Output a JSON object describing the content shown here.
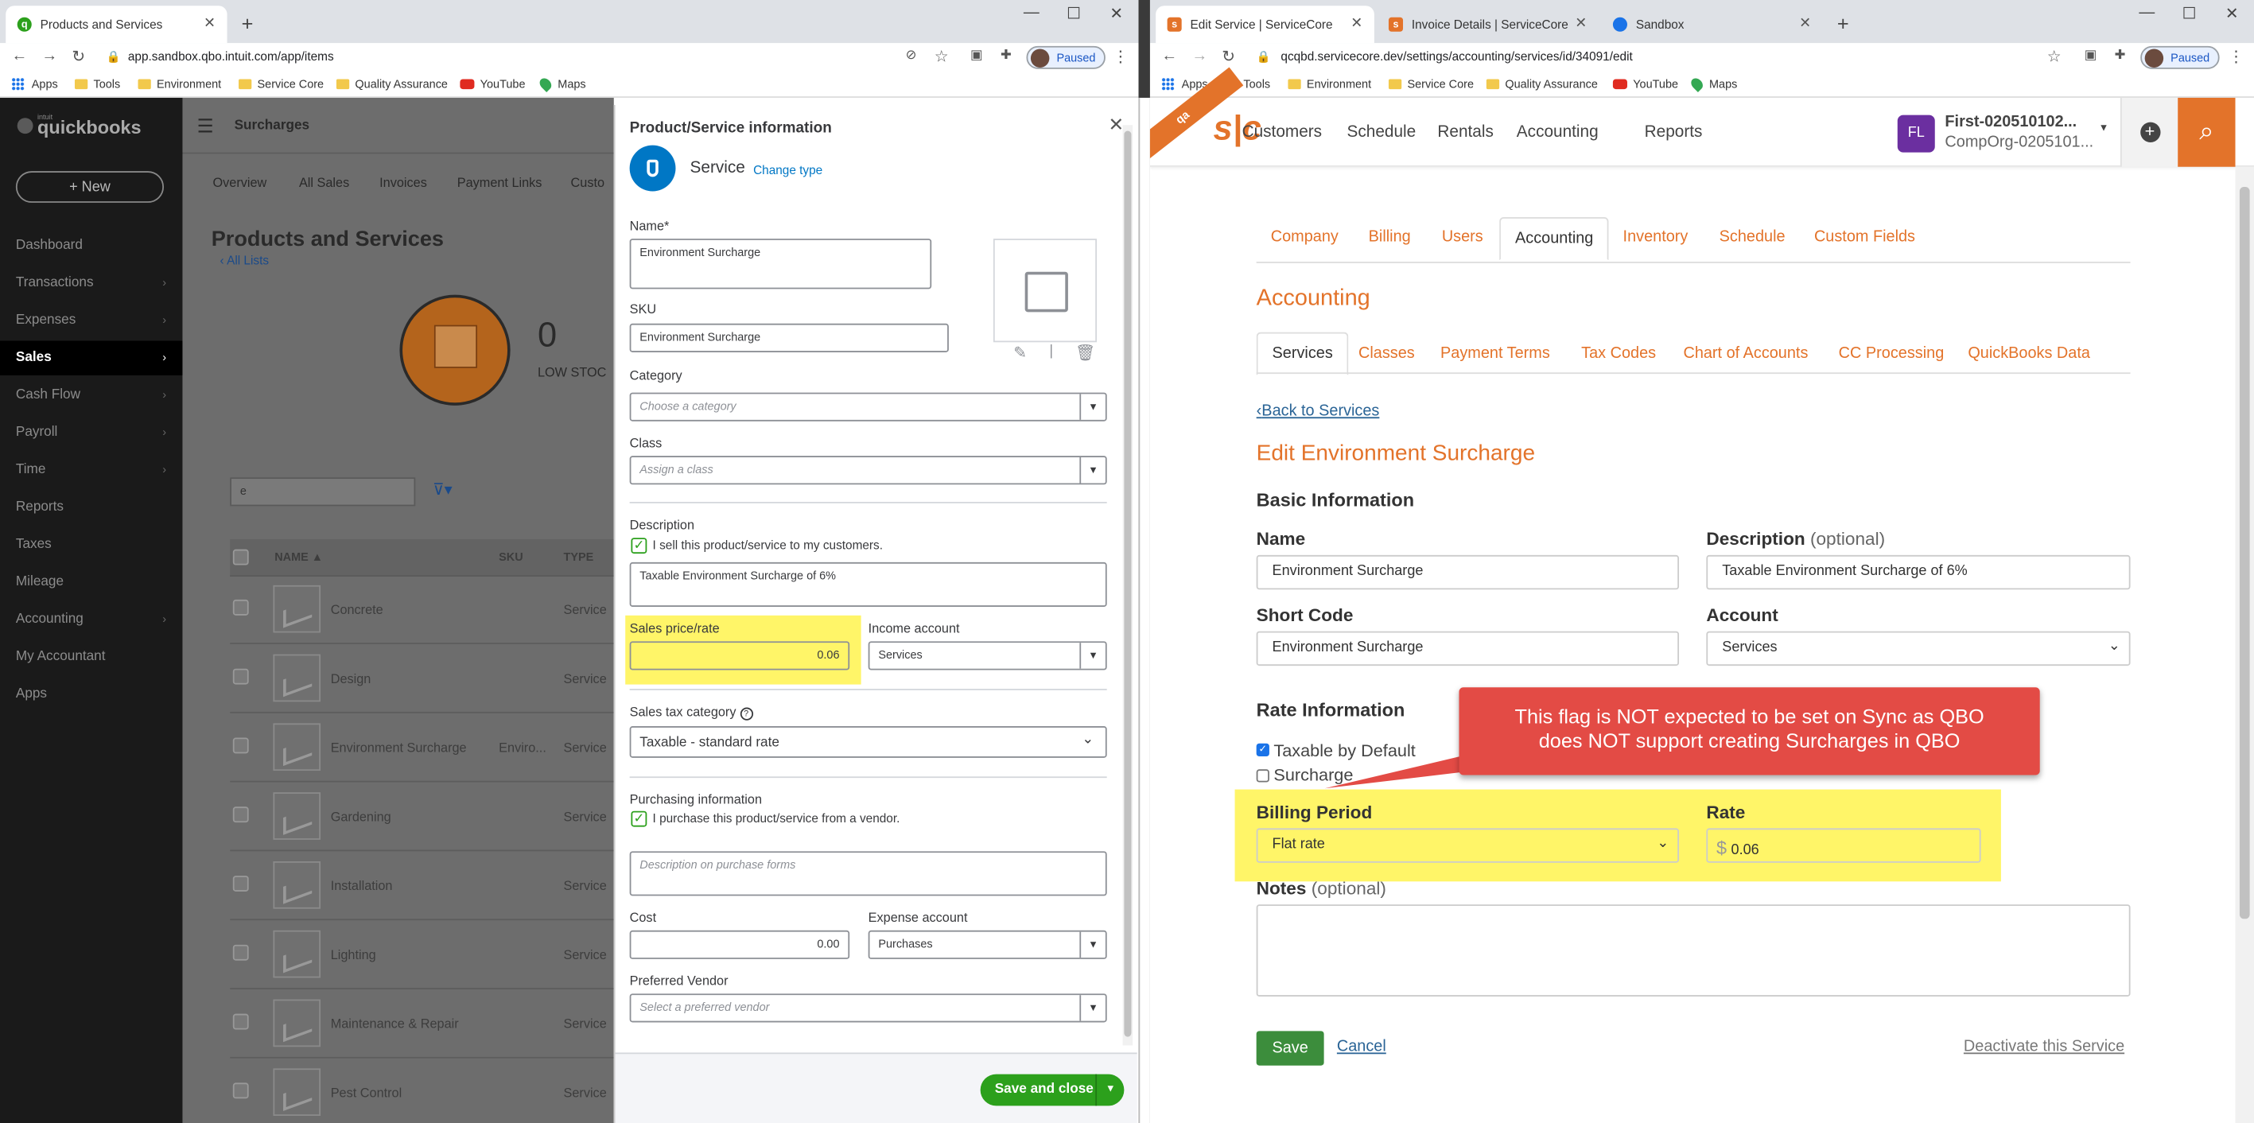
{
  "qbo_window": {
    "tab_title": "Products and Services",
    "url": "app.sandbox.qbo.intuit.com/app/items",
    "paused_label": "Paused",
    "bookmarks": [
      "Apps",
      "Tools",
      "Environment",
      "Service Core",
      "Quality Assurance",
      "YouTube",
      "Maps"
    ],
    "logo": "quickbooks",
    "logo_small": "intuit",
    "new_button": "+ New",
    "sidebar": [
      "Dashboard",
      "Transactions",
      "Expenses",
      "Sales",
      "Cash Flow",
      "Payroll",
      "Time",
      "Reports",
      "Taxes",
      "Mileage",
      "Accounting",
      "My Accountant",
      "Apps"
    ],
    "sidebar_active": "Sales",
    "header_title": "Surcharges",
    "subtabs": [
      "Overview",
      "All Sales",
      "Invoices",
      "Payment Links",
      "Custo"
    ],
    "page_title": "Products and Services",
    "all_lists": "All Lists",
    "low_stock_count": "0",
    "low_stock_label": "LOW STOC",
    "search_value": "e",
    "columns": [
      "NAME ▲",
      "SKU",
      "TYPE"
    ],
    "rows": [
      {
        "name": "Concrete",
        "sku": "",
        "type": "Service"
      },
      {
        "name": "Design",
        "sku": "",
        "type": "Service"
      },
      {
        "name": "Environment Surcharge",
        "sku": "Enviro...",
        "type": "Service"
      },
      {
        "name": "Gardening",
        "sku": "",
        "type": "Service"
      },
      {
        "name": "Installation",
        "sku": "",
        "type": "Service"
      },
      {
        "name": "Lighting",
        "sku": "",
        "type": "Service"
      },
      {
        "name": "Maintenance & Repair",
        "sku": "",
        "type": "Service"
      },
      {
        "name": "Pest Control",
        "sku": "",
        "type": "Service"
      }
    ]
  },
  "drawer": {
    "title": "Product/Service information",
    "type_label": "Service",
    "change_type": "Change type",
    "name_label": "Name*",
    "name_value": "Environment Surcharge",
    "sku_label": "SKU",
    "sku_value": "Environment Surcharge",
    "category_label": "Category",
    "category_placeholder": "Choose a category",
    "class_label": "Class",
    "class_placeholder": "Assign a class",
    "description_label": "Description",
    "sell_checkbox": "I sell this product/service to my customers.",
    "description_value": "Taxable Environment Surcharge of 6%",
    "price_label": "Sales price/rate",
    "price_value": "0.06",
    "income_label": "Income account",
    "income_value": "Services",
    "tax_label": "Sales tax category",
    "tax_value": "Taxable - standard rate",
    "purchasing_label": "Purchasing information",
    "purchase_checkbox": "I purchase this product/service from a vendor.",
    "purchase_desc_placeholder": "Description on purchase forms",
    "cost_label": "Cost",
    "cost_value": "0.00",
    "expense_label": "Expense account",
    "expense_value": "Purchases",
    "vendor_label": "Preferred Vendor",
    "vendor_placeholder": "Select a preferred vendor",
    "save_close": "Save and close"
  },
  "sc_window": {
    "tabs": [
      "Edit Service | ServiceCore",
      "Invoice Details | ServiceCore",
      "Sandbox"
    ],
    "url": "qcqbd.servicecore.dev/settings/accounting/services/id/34091/edit",
    "paused_label": "Paused",
    "bookmarks": [
      "Apps",
      "Tools",
      "Environment",
      "Service Core",
      "Quality Assurance",
      "YouTube",
      "Maps"
    ],
    "badge": "qa",
    "logo": "s|c",
    "nav": [
      "Customers",
      "Schedule",
      "Rentals",
      "Accounting",
      "Reports"
    ],
    "user_initials": "FL",
    "user_name": "First-020510102...",
    "user_org": "CompOrg-0205101...",
    "settings_tabs": [
      "Company",
      "Billing",
      "Users",
      "Accounting",
      "Inventory",
      "Schedule",
      "Custom Fields"
    ],
    "section_title": "Accounting",
    "sub_tabs": [
      "Services",
      "Classes",
      "Payment Terms",
      "Tax Codes",
      "Chart of Accounts",
      "CC Processing",
      "QuickBooks Data"
    ],
    "back_link": "Back to Services",
    "edit_title": "Edit Environment Surcharge",
    "basic_info": "Basic Information",
    "name_label": "Name",
    "name_value": "Environment Surcharge",
    "description_label": "Description",
    "optional": "(optional)",
    "description_value": "Taxable Environment Surcharge of 6%",
    "short_code_label": "Short Code",
    "short_code_value": "Environment Surcharge",
    "account_label": "Account",
    "account_value": "Services",
    "rate_info": "Rate Information",
    "taxable_label": "Taxable by Default",
    "surcharge_label": "Surcharge",
    "callout": "This flag is NOT expected to be set on Sync as QBO does NOT support creating Surcharges in QBO",
    "billing_period_label": "Billing Period",
    "billing_period_value": "Flat rate",
    "rate_label": "Rate",
    "rate_symbol": "$",
    "rate_value": "0.06",
    "notes_label": "Notes",
    "save": "Save",
    "cancel": "Cancel",
    "deactivate": "Deactivate this Service"
  }
}
